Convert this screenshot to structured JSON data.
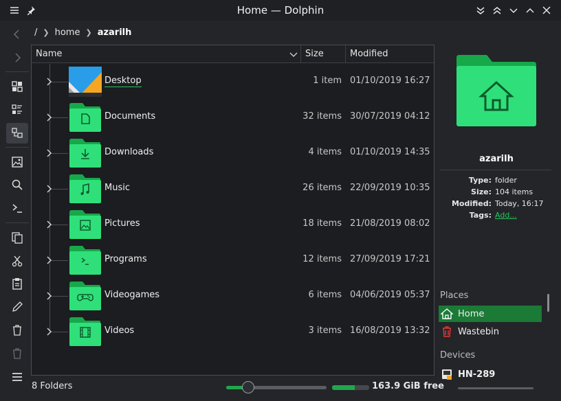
{
  "window": {
    "title": "Home — Dolphin"
  },
  "breadcrumb": {
    "root": "/",
    "items": [
      "home"
    ],
    "current": "azarilh"
  },
  "columns": {
    "name": "Name",
    "size": "Size",
    "modified": "Modified"
  },
  "files": [
    {
      "name": "Desktop",
      "size": "1 item",
      "modified": "01/10/2019 16:27",
      "icon": "desktop-wallpaper-icon"
    },
    {
      "name": "Documents",
      "size": "32 items",
      "modified": "30/07/2019 04:12",
      "icon": "documents-folder-icon"
    },
    {
      "name": "Downloads",
      "size": "4 items",
      "modified": "01/10/2019 14:35",
      "icon": "downloads-folder-icon"
    },
    {
      "name": "Music",
      "size": "26 items",
      "modified": "22/09/2019 10:35",
      "icon": "music-folder-icon"
    },
    {
      "name": "Pictures",
      "size": "18 items",
      "modified": "21/08/2019 08:02",
      "icon": "pictures-folder-icon"
    },
    {
      "name": "Programs",
      "size": "12 items",
      "modified": "27/09/2019 17:21",
      "icon": "programs-folder-icon"
    },
    {
      "name": "Videogames",
      "size": "6 items",
      "modified": "04/06/2019 05:37",
      "icon": "videogames-folder-icon"
    },
    {
      "name": "Videos",
      "size": "3 items",
      "modified": "16/08/2019 13:32",
      "icon": "videos-folder-icon"
    }
  ],
  "status": {
    "summary": "8 Folders",
    "free_space": "163.9 GiB free",
    "zoom_fraction": 0.22,
    "used_fraction": 0.62
  },
  "info": {
    "name": "azarilh",
    "meta": [
      {
        "key": "Type:",
        "value": "folder"
      },
      {
        "key": "Size:",
        "value": "104 items"
      },
      {
        "key": "Modified:",
        "value": "Today, 16:17"
      },
      {
        "key": "Tags:",
        "value": "Add..."
      }
    ]
  },
  "places": {
    "title": "Places",
    "items": [
      {
        "label": "Home",
        "selected": true,
        "icon": "home-icon"
      },
      {
        "label": "Wastebin",
        "selected": false,
        "icon": "trash-icon"
      }
    ]
  },
  "devices": {
    "title": "Devices",
    "items": [
      {
        "label": "HN-289",
        "icon": "drive-icon"
      }
    ]
  },
  "colors": {
    "accent": "#1fa84a",
    "folder": "#2fe07a",
    "folder_dark": "#17a84a",
    "selection": "#1a7a36"
  }
}
